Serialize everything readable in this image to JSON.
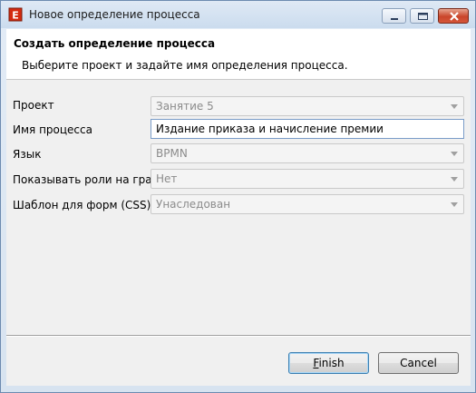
{
  "window": {
    "title": "Новое определение процесса"
  },
  "header": {
    "title": "Создать определение процесса",
    "description": "Выберите проект и задайте имя определения процесса."
  },
  "form": {
    "project": {
      "label": "Проект",
      "value": "Занятие 5"
    },
    "process_name": {
      "label": "Имя процесса",
      "value": "Издание приказа и начисление премии"
    },
    "language": {
      "label": "Язык",
      "value": "BPMN"
    },
    "show_roles": {
      "label": "Показывать роли на графе",
      "value": "Нет"
    },
    "form_template": {
      "label": "Шаблон для форм (CSS)",
      "value": "Унаследован"
    }
  },
  "buttons": {
    "finish_first": "F",
    "finish_rest": "inish",
    "cancel": "Cancel"
  },
  "colors": {
    "accent": "#3c7fb1",
    "close_button": "#c9462b",
    "app_icon": "#d42a10"
  },
  "icons": {
    "app": "eclipse-process-icon",
    "minimize": "minimize-icon",
    "maximize": "maximize-icon",
    "close": "close-icon",
    "dropdown": "chevron-down-icon"
  }
}
